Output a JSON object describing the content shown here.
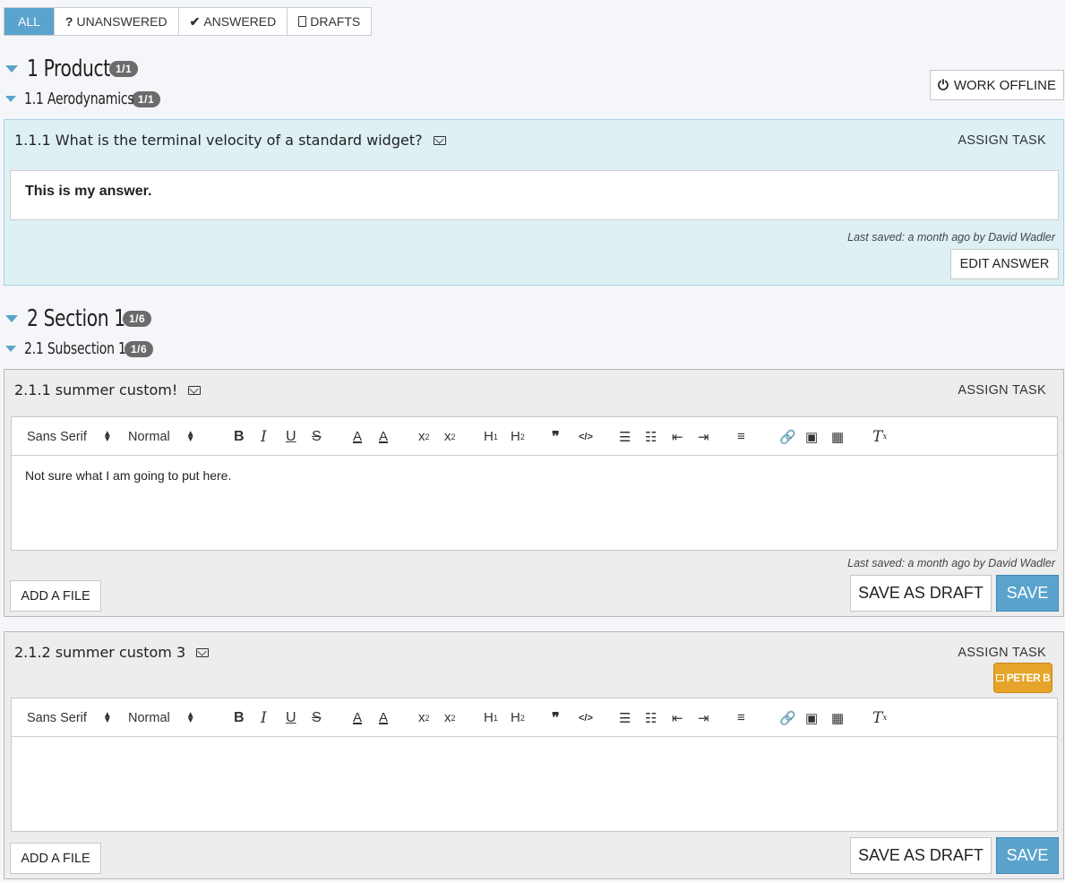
{
  "filters": {
    "all": "ALL",
    "unanswered": "UNANSWERED",
    "answered": "ANSWERED",
    "drafts": "DRAFTS"
  },
  "work_offline": "WORK OFFLINE",
  "sections": [
    {
      "title": "1 Product",
      "badge": "1/1",
      "subsection": {
        "title": "1.1 Aerodynamics",
        "badge": "1/1"
      },
      "question": {
        "title": "1.1.1 What is the terminal velocity of a standard widget?",
        "assign": "ASSIGN TASK",
        "answer": "This is my answer.",
        "last_saved": "Last saved: a month ago by David Wadler",
        "edit_label": "EDIT ANSWER"
      }
    },
    {
      "title": "2 Section 1",
      "badge": "1/6",
      "subsection": {
        "title": "2.1 Subsection 1",
        "badge": "1/6"
      },
      "questions": [
        {
          "title": "2.1.1 summer custom!",
          "assign": "ASSIGN TASK",
          "body": "Not sure what I am going to put here.",
          "last_saved": "Last saved: a month ago by David Wadler",
          "add_file": "ADD A FILE",
          "save_draft": "SAVE AS DRAFT",
          "save": "SAVE"
        },
        {
          "title": "2.1.2 summer custom 3",
          "assign": "ASSIGN TASK",
          "assignee": "PETER B",
          "body": "",
          "add_file": "ADD A FILE",
          "save_draft": "SAVE AS DRAFT",
          "save": "SAVE"
        }
      ]
    }
  ],
  "toolbar": {
    "font": "Sans Serif",
    "size": "Normal"
  },
  "colors": {
    "accent": "#5aa3cc",
    "answered_bg": "#dff0f5",
    "assignee": "#e6a52a"
  }
}
